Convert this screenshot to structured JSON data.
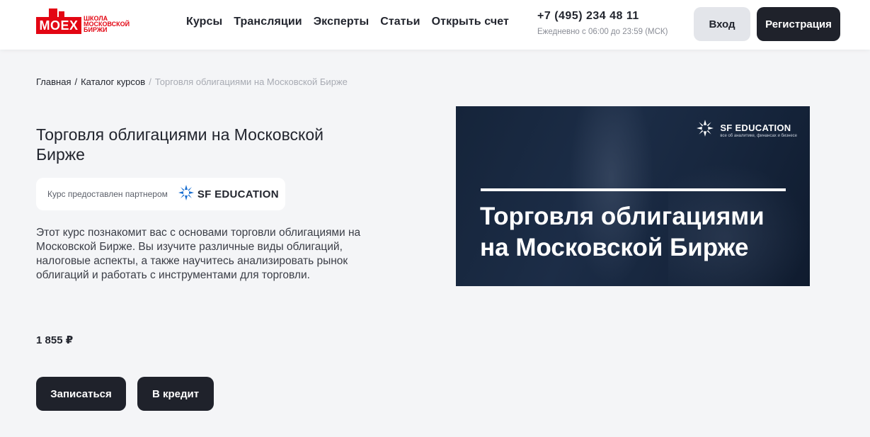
{
  "header": {
    "logo_mark": "MOEX",
    "logo_text_lines": [
      "ШКОЛА",
      "МОСКОВСКОЙ",
      "БИРЖИ"
    ],
    "nav": [
      {
        "label": "Курсы"
      },
      {
        "label": "Трансляции"
      },
      {
        "label": "Эксперты"
      },
      {
        "label": "Статьи"
      },
      {
        "label": "Открыть счет"
      }
    ],
    "phone": "+7 (495) 234 48 11",
    "hours": "Ежедневно с 06:00 до 23:59 (МСК)",
    "login_label": "Вход",
    "register_label": "Регистрация"
  },
  "breadcrumb": {
    "home": "Главная",
    "catalog": "Каталог курсов",
    "current": "Торговля облигациями на Московской Бирже",
    "separator": "/"
  },
  "course": {
    "title": "Торговля облигациями на Московской Бирже",
    "partner_label": "Курс предоставлен партнером",
    "partner_name": "SF EDUCATION",
    "description": "Этот курс познакомит вас с основами торговли облигациями на Московской Бирже. Вы изучите различные виды облигаций, налоговые аспекты, а также научитесь анализировать рынок облигаций и работать с инструментами для торговли.",
    "price": "1 855 ₽",
    "enroll_label": "Записаться",
    "credit_label": "В кредит"
  },
  "banner": {
    "brand_name": "SF EDUCATION",
    "brand_tagline": "все об аналитике, финансах и бизнесе",
    "title_line1": "Торговля облигациями",
    "title_line2": "на Московской Бирже"
  },
  "colors": {
    "brand_red": "#e30613",
    "dark_button": "#1f222b",
    "light_button": "#e3e5ea",
    "page_bg": "#f4f5f7",
    "banner_bg": "#1a2a42"
  },
  "icons": {
    "partner_logo": "sf-education-star-icon"
  }
}
